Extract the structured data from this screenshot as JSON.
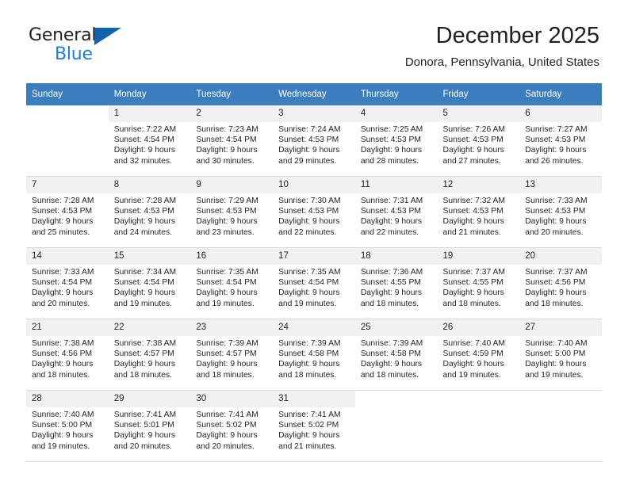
{
  "brand": {
    "name_part1": "General",
    "name_part2": "Blue",
    "colors": {
      "dark": "#231f20",
      "blue": "#1a7fd4",
      "triangle": "#1263ad"
    }
  },
  "header": {
    "title": "December 2025",
    "subtitle": "Donora, Pennsylvania, United States"
  },
  "calendar": {
    "header_bg": "#3b7ebf",
    "daynum_bg": "#f1f1f1",
    "weekdays": [
      "Sunday",
      "Monday",
      "Tuesday",
      "Wednesday",
      "Thursday",
      "Friday",
      "Saturday"
    ],
    "weeks": [
      [
        {
          "day": "",
          "lines": []
        },
        {
          "day": "1",
          "lines": [
            "Sunrise: 7:22 AM",
            "Sunset: 4:54 PM",
            "Daylight: 9 hours",
            "and 32 minutes."
          ]
        },
        {
          "day": "2",
          "lines": [
            "Sunrise: 7:23 AM",
            "Sunset: 4:54 PM",
            "Daylight: 9 hours",
            "and 30 minutes."
          ]
        },
        {
          "day": "3",
          "lines": [
            "Sunrise: 7:24 AM",
            "Sunset: 4:53 PM",
            "Daylight: 9 hours",
            "and 29 minutes."
          ]
        },
        {
          "day": "4",
          "lines": [
            "Sunrise: 7:25 AM",
            "Sunset: 4:53 PM",
            "Daylight: 9 hours",
            "and 28 minutes."
          ]
        },
        {
          "day": "5",
          "lines": [
            "Sunrise: 7:26 AM",
            "Sunset: 4:53 PM",
            "Daylight: 9 hours",
            "and 27 minutes."
          ]
        },
        {
          "day": "6",
          "lines": [
            "Sunrise: 7:27 AM",
            "Sunset: 4:53 PM",
            "Daylight: 9 hours",
            "and 26 minutes."
          ]
        }
      ],
      [
        {
          "day": "7",
          "lines": [
            "Sunrise: 7:28 AM",
            "Sunset: 4:53 PM",
            "Daylight: 9 hours",
            "and 25 minutes."
          ]
        },
        {
          "day": "8",
          "lines": [
            "Sunrise: 7:28 AM",
            "Sunset: 4:53 PM",
            "Daylight: 9 hours",
            "and 24 minutes."
          ]
        },
        {
          "day": "9",
          "lines": [
            "Sunrise: 7:29 AM",
            "Sunset: 4:53 PM",
            "Daylight: 9 hours",
            "and 23 minutes."
          ]
        },
        {
          "day": "10",
          "lines": [
            "Sunrise: 7:30 AM",
            "Sunset: 4:53 PM",
            "Daylight: 9 hours",
            "and 22 minutes."
          ]
        },
        {
          "day": "11",
          "lines": [
            "Sunrise: 7:31 AM",
            "Sunset: 4:53 PM",
            "Daylight: 9 hours",
            "and 22 minutes."
          ]
        },
        {
          "day": "12",
          "lines": [
            "Sunrise: 7:32 AM",
            "Sunset: 4:53 PM",
            "Daylight: 9 hours",
            "and 21 minutes."
          ]
        },
        {
          "day": "13",
          "lines": [
            "Sunrise: 7:33 AM",
            "Sunset: 4:53 PM",
            "Daylight: 9 hours",
            "and 20 minutes."
          ]
        }
      ],
      [
        {
          "day": "14",
          "lines": [
            "Sunrise: 7:33 AM",
            "Sunset: 4:54 PM",
            "Daylight: 9 hours",
            "and 20 minutes."
          ]
        },
        {
          "day": "15",
          "lines": [
            "Sunrise: 7:34 AM",
            "Sunset: 4:54 PM",
            "Daylight: 9 hours",
            "and 19 minutes."
          ]
        },
        {
          "day": "16",
          "lines": [
            "Sunrise: 7:35 AM",
            "Sunset: 4:54 PM",
            "Daylight: 9 hours",
            "and 19 minutes."
          ]
        },
        {
          "day": "17",
          "lines": [
            "Sunrise: 7:35 AM",
            "Sunset: 4:54 PM",
            "Daylight: 9 hours",
            "and 19 minutes."
          ]
        },
        {
          "day": "18",
          "lines": [
            "Sunrise: 7:36 AM",
            "Sunset: 4:55 PM",
            "Daylight: 9 hours",
            "and 18 minutes."
          ]
        },
        {
          "day": "19",
          "lines": [
            "Sunrise: 7:37 AM",
            "Sunset: 4:55 PM",
            "Daylight: 9 hours",
            "and 18 minutes."
          ]
        },
        {
          "day": "20",
          "lines": [
            "Sunrise: 7:37 AM",
            "Sunset: 4:56 PM",
            "Daylight: 9 hours",
            "and 18 minutes."
          ]
        }
      ],
      [
        {
          "day": "21",
          "lines": [
            "Sunrise: 7:38 AM",
            "Sunset: 4:56 PM",
            "Daylight: 9 hours",
            "and 18 minutes."
          ]
        },
        {
          "day": "22",
          "lines": [
            "Sunrise: 7:38 AM",
            "Sunset: 4:57 PM",
            "Daylight: 9 hours",
            "and 18 minutes."
          ]
        },
        {
          "day": "23",
          "lines": [
            "Sunrise: 7:39 AM",
            "Sunset: 4:57 PM",
            "Daylight: 9 hours",
            "and 18 minutes."
          ]
        },
        {
          "day": "24",
          "lines": [
            "Sunrise: 7:39 AM",
            "Sunset: 4:58 PM",
            "Daylight: 9 hours",
            "and 18 minutes."
          ]
        },
        {
          "day": "25",
          "lines": [
            "Sunrise: 7:39 AM",
            "Sunset: 4:58 PM",
            "Daylight: 9 hours",
            "and 18 minutes."
          ]
        },
        {
          "day": "26",
          "lines": [
            "Sunrise: 7:40 AM",
            "Sunset: 4:59 PM",
            "Daylight: 9 hours",
            "and 19 minutes."
          ]
        },
        {
          "day": "27",
          "lines": [
            "Sunrise: 7:40 AM",
            "Sunset: 5:00 PM",
            "Daylight: 9 hours",
            "and 19 minutes."
          ]
        }
      ],
      [
        {
          "day": "28",
          "lines": [
            "Sunrise: 7:40 AM",
            "Sunset: 5:00 PM",
            "Daylight: 9 hours",
            "and 19 minutes."
          ]
        },
        {
          "day": "29",
          "lines": [
            "Sunrise: 7:41 AM",
            "Sunset: 5:01 PM",
            "Daylight: 9 hours",
            "and 20 minutes."
          ]
        },
        {
          "day": "30",
          "lines": [
            "Sunrise: 7:41 AM",
            "Sunset: 5:02 PM",
            "Daylight: 9 hours",
            "and 20 minutes."
          ]
        },
        {
          "day": "31",
          "lines": [
            "Sunrise: 7:41 AM",
            "Sunset: 5:02 PM",
            "Daylight: 9 hours",
            "and 21 minutes."
          ]
        },
        {
          "day": "",
          "lines": []
        },
        {
          "day": "",
          "lines": []
        },
        {
          "day": "",
          "lines": []
        }
      ]
    ]
  }
}
